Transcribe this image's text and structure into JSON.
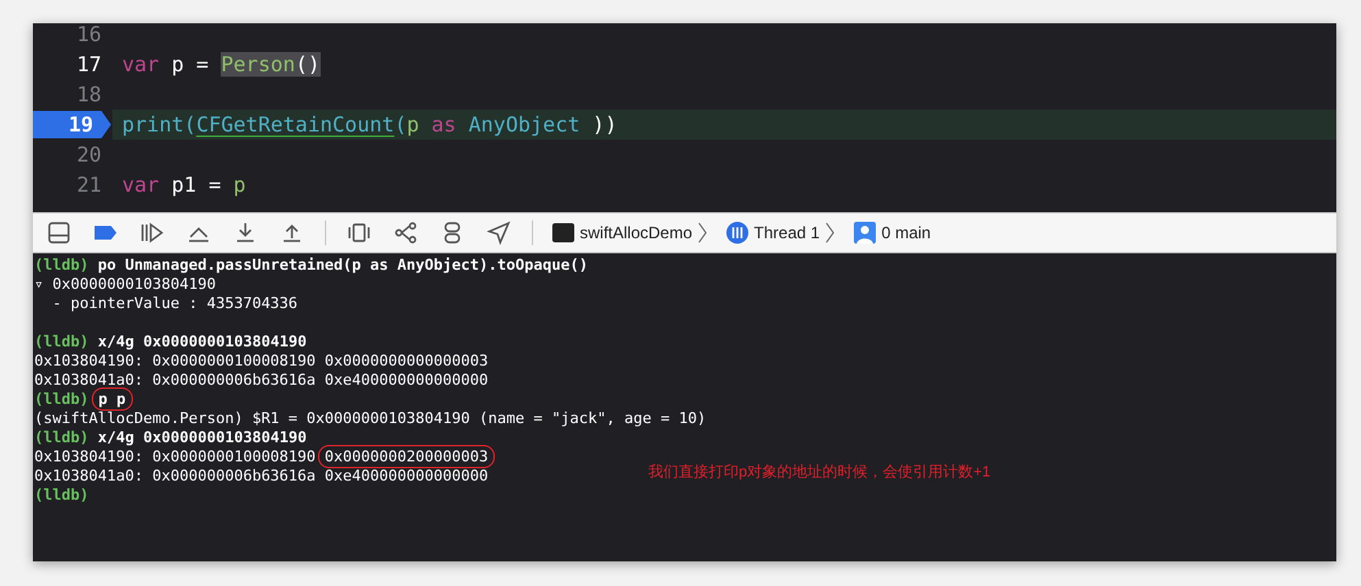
{
  "editor": {
    "lines": [
      {
        "number": "16",
        "breakpoint": false,
        "current": false,
        "bright": false
      },
      {
        "number": "17",
        "breakpoint": false,
        "current": false,
        "bright": true,
        "tokens": [
          {
            "kind": "keyword",
            "text": "var"
          },
          {
            "kind": "plain",
            "text": " p = "
          },
          {
            "kind": "project",
            "text": "Person",
            "highlighted": true
          },
          {
            "kind": "plain",
            "text": "()",
            "highlighted": true
          }
        ]
      },
      {
        "number": "18",
        "breakpoint": false,
        "current": false,
        "bright": false
      },
      {
        "number": "19",
        "breakpoint": true,
        "current": true,
        "bright": true,
        "tokens": [
          {
            "kind": "system",
            "text": "print("
          },
          {
            "kind": "system",
            "text": "CFGetRetainCount",
            "underlined": true
          },
          {
            "kind": "system",
            "text": "("
          },
          {
            "kind": "project",
            "text": "p"
          },
          {
            "kind": "keyword",
            "text": " as"
          },
          {
            "kind": "system",
            "text": " AnyObject"
          },
          {
            "kind": "plain",
            "text": " ))"
          }
        ]
      },
      {
        "number": "20",
        "breakpoint": false,
        "current": false,
        "bright": false
      },
      {
        "number": "21",
        "breakpoint": false,
        "current": false,
        "bright": false,
        "tokens": [
          {
            "kind": "keyword",
            "text": "var"
          },
          {
            "kind": "plain",
            "text": " p1 = "
          },
          {
            "kind": "project",
            "text": "p"
          }
        ]
      }
    ]
  },
  "debug_bar": {
    "breakpoints_active": true,
    "breadcrumbs": [
      {
        "kind": "app",
        "label": "swiftAllocDemo"
      },
      {
        "kind": "thread",
        "label": "Thread 1"
      },
      {
        "kind": "frame",
        "label": "0 main"
      }
    ]
  },
  "console": {
    "lines": [
      {
        "kind": "text",
        "segments": [
          {
            "kind": "prompt",
            "text": "(lldb)"
          },
          {
            "kind": "command",
            "text": " po Unmanaged.passUnretained(p as AnyObject).toOpaque()"
          }
        ]
      },
      {
        "kind": "text",
        "segments": [
          {
            "kind": "output",
            "text": "▿ 0x0000000103804190"
          }
        ]
      },
      {
        "kind": "text",
        "segments": [
          {
            "kind": "output",
            "text": "  - pointerValue : 4353704336"
          }
        ]
      },
      {
        "kind": "blank"
      },
      {
        "kind": "text",
        "segments": [
          {
            "kind": "prompt",
            "text": "(lldb)"
          },
          {
            "kind": "command",
            "text": " x/4g 0x0000000103804190"
          }
        ]
      },
      {
        "kind": "text",
        "segments": [
          {
            "kind": "output",
            "text": "0x103804190: 0x0000000100008190 0x0000000000000003"
          }
        ]
      },
      {
        "kind": "text",
        "segments": [
          {
            "kind": "output",
            "text": "0x1038041a0: 0x000000006b63616a 0xe400000000000000"
          }
        ]
      },
      {
        "kind": "text",
        "segments": [
          {
            "kind": "prompt",
            "text": "(lldb)"
          },
          {
            "kind": "command",
            "text": "p p",
            "circled": true
          }
        ]
      },
      {
        "kind": "text",
        "segments": [
          {
            "kind": "output",
            "text": "(swiftAllocDemo.Person) $R1 = 0x0000000103804190 (name = \"jack\", age = 10)"
          }
        ]
      },
      {
        "kind": "text",
        "segments": [
          {
            "kind": "prompt",
            "text": "(lldb)"
          },
          {
            "kind": "command",
            "text": " x/4g 0x0000000103804190"
          }
        ]
      },
      {
        "kind": "text",
        "segments": [
          {
            "kind": "output",
            "text": "0x103804190: 0x0000000100008190 "
          },
          {
            "kind": "output",
            "text": "0x0000000200000003",
            "circled": true
          }
        ]
      },
      {
        "kind": "text",
        "segments": [
          {
            "kind": "output",
            "text": "0x1038041a0: 0x000000006b63616a 0xe400000000000000"
          }
        ]
      },
      {
        "kind": "text",
        "segments": [
          {
            "kind": "prompt",
            "text": "(lldb)"
          }
        ]
      }
    ],
    "note": "我们直接打印p对象的地址的时候，会使引用计数+1"
  }
}
